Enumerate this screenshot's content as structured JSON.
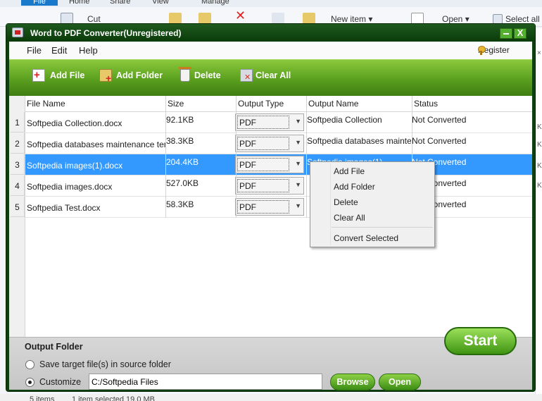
{
  "background": {
    "ribbon_tabs": [
      "File",
      "Home",
      "Share",
      "View",
      "Manage"
    ],
    "ribbon_items": {
      "cut": "Cut",
      "new_item": "New item",
      "open": "Open",
      "select_all": "Select all"
    },
    "status": {
      "items": "5 items",
      "selected": "1 item selected  19.0 MB"
    }
  },
  "window": {
    "title": "Word to PDF Converter(Unregistered)",
    "min_glyph": "",
    "close_glyph": "X"
  },
  "menu": {
    "file": "File",
    "edit": "Edit",
    "help": "Help",
    "register": "Register"
  },
  "toolbar": {
    "add_file": "Add File",
    "add_folder": "Add Folder",
    "delete": "Delete",
    "clear_all": "Clear All"
  },
  "table": {
    "columns": [
      "File Name",
      "Size",
      "Output Type",
      "Output Name",
      "Status"
    ],
    "rows": [
      {
        "num": "1",
        "name": "Softpedia Collection.docx",
        "size": "92.1KB",
        "type": "PDF",
        "output": "Softpedia Collection",
        "status": "Not Converted"
      },
      {
        "num": "2",
        "name": "Softpedia databases maintenance tem",
        "size": "38.3KB",
        "type": "PDF",
        "output": "Softpedia databases mainte",
        "status": "Not Converted"
      },
      {
        "num": "3",
        "name": "Softpedia images(1).docx",
        "size": "204.4KB",
        "type": "PDF",
        "output": "Softpedia images(1)",
        "status": "Not Converted"
      },
      {
        "num": "4",
        "name": "Softpedia images.docx",
        "size": "527.0KB",
        "type": "PDF",
        "output": "",
        "status": "Not Converted"
      },
      {
        "num": "5",
        "name": "Softpedia Test.docx",
        "size": "58.3KB",
        "type": "PDF",
        "output": "",
        "status": "Not Converted"
      }
    ],
    "selected_row": 3
  },
  "context_menu": {
    "items": [
      "Add File",
      "Add Folder",
      "Delete",
      "Clear All",
      "Convert Selected"
    ]
  },
  "output_folder": {
    "title": "Output Folder",
    "option_source": "Save target file(s) in source folder",
    "option_custom": "Customize",
    "selected": "custom",
    "path": "C:/Softpedia Files",
    "browse": "Browse",
    "open": "Open",
    "start": "Start"
  },
  "colors": {
    "accent_green": "#5a9f1e",
    "selection_blue": "#3399ff",
    "title_bar": "#0e3f0e"
  }
}
